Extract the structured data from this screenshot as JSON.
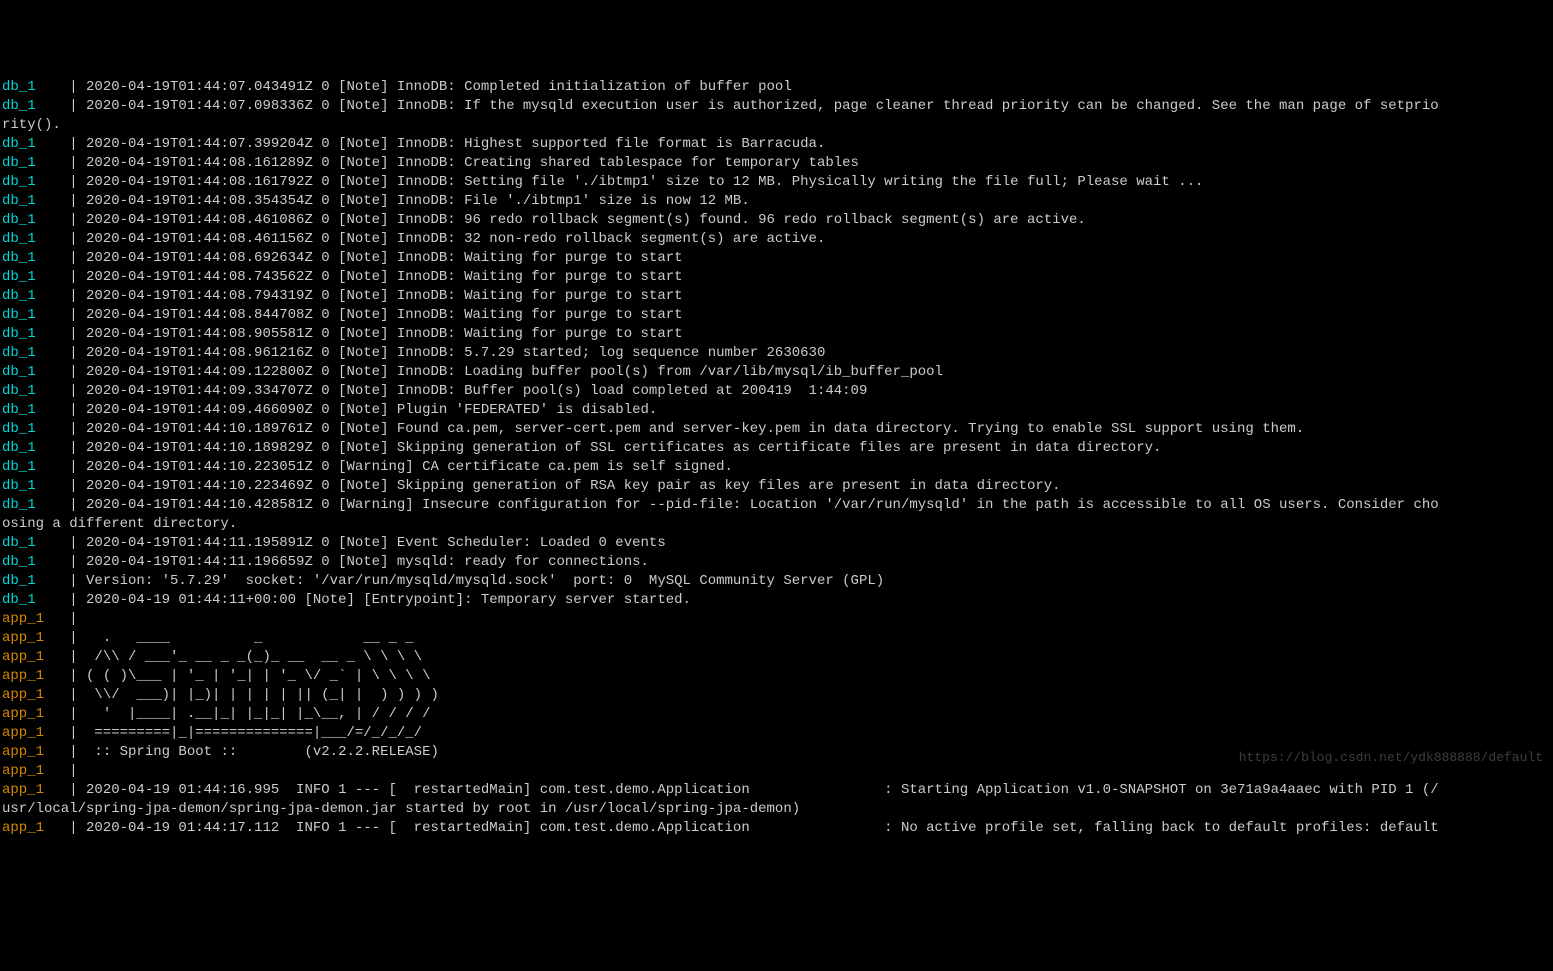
{
  "watermark": "https://blog.csdn.net/ydk888888/default",
  "lines": [
    {
      "prefix": "db_1    ",
      "prefixClass": "db-prefix",
      "text": "| 2020-04-19T01:44:07.043491Z 0 [Note] InnoDB: Completed initialization of buffer pool"
    },
    {
      "prefix": "db_1    ",
      "prefixClass": "db-prefix",
      "text": "| 2020-04-19T01:44:07.098336Z 0 [Note] InnoDB: If the mysqld execution user is authorized, page cleaner thread priority can be changed. See the man page of setprio"
    },
    {
      "prefix": "",
      "prefixClass": "log-text",
      "text": "rity()."
    },
    {
      "prefix": "db_1    ",
      "prefixClass": "db-prefix",
      "text": "| 2020-04-19T01:44:07.399204Z 0 [Note] InnoDB: Highest supported file format is Barracuda."
    },
    {
      "prefix": "db_1    ",
      "prefixClass": "db-prefix",
      "text": "| 2020-04-19T01:44:08.161289Z 0 [Note] InnoDB: Creating shared tablespace for temporary tables"
    },
    {
      "prefix": "db_1    ",
      "prefixClass": "db-prefix",
      "text": "| 2020-04-19T01:44:08.161792Z 0 [Note] InnoDB: Setting file './ibtmp1' size to 12 MB. Physically writing the file full; Please wait ..."
    },
    {
      "prefix": "db_1    ",
      "prefixClass": "db-prefix",
      "text": "| 2020-04-19T01:44:08.354354Z 0 [Note] InnoDB: File './ibtmp1' size is now 12 MB."
    },
    {
      "prefix": "db_1    ",
      "prefixClass": "db-prefix",
      "text": "| 2020-04-19T01:44:08.461086Z 0 [Note] InnoDB: 96 redo rollback segment(s) found. 96 redo rollback segment(s) are active."
    },
    {
      "prefix": "db_1    ",
      "prefixClass": "db-prefix",
      "text": "| 2020-04-19T01:44:08.461156Z 0 [Note] InnoDB: 32 non-redo rollback segment(s) are active."
    },
    {
      "prefix": "db_1    ",
      "prefixClass": "db-prefix",
      "text": "| 2020-04-19T01:44:08.692634Z 0 [Note] InnoDB: Waiting for purge to start"
    },
    {
      "prefix": "db_1    ",
      "prefixClass": "db-prefix",
      "text": "| 2020-04-19T01:44:08.743562Z 0 [Note] InnoDB: Waiting for purge to start"
    },
    {
      "prefix": "db_1    ",
      "prefixClass": "db-prefix",
      "text": "| 2020-04-19T01:44:08.794319Z 0 [Note] InnoDB: Waiting for purge to start"
    },
    {
      "prefix": "db_1    ",
      "prefixClass": "db-prefix",
      "text": "| 2020-04-19T01:44:08.844708Z 0 [Note] InnoDB: Waiting for purge to start"
    },
    {
      "prefix": "db_1    ",
      "prefixClass": "db-prefix",
      "text": "| 2020-04-19T01:44:08.905581Z 0 [Note] InnoDB: Waiting for purge to start"
    },
    {
      "prefix": "db_1    ",
      "prefixClass": "db-prefix",
      "text": "| 2020-04-19T01:44:08.961216Z 0 [Note] InnoDB: 5.7.29 started; log sequence number 2630630"
    },
    {
      "prefix": "db_1    ",
      "prefixClass": "db-prefix",
      "text": "| 2020-04-19T01:44:09.122800Z 0 [Note] InnoDB: Loading buffer pool(s) from /var/lib/mysql/ib_buffer_pool"
    },
    {
      "prefix": "db_1    ",
      "prefixClass": "db-prefix",
      "text": "| 2020-04-19T01:44:09.334707Z 0 [Note] InnoDB: Buffer pool(s) load completed at 200419  1:44:09"
    },
    {
      "prefix": "db_1    ",
      "prefixClass": "db-prefix",
      "text": "| 2020-04-19T01:44:09.466090Z 0 [Note] Plugin 'FEDERATED' is disabled."
    },
    {
      "prefix": "db_1    ",
      "prefixClass": "db-prefix",
      "text": "| 2020-04-19T01:44:10.189761Z 0 [Note] Found ca.pem, server-cert.pem and server-key.pem in data directory. Trying to enable SSL support using them."
    },
    {
      "prefix": "db_1    ",
      "prefixClass": "db-prefix",
      "text": "| 2020-04-19T01:44:10.189829Z 0 [Note] Skipping generation of SSL certificates as certificate files are present in data directory."
    },
    {
      "prefix": "db_1    ",
      "prefixClass": "db-prefix",
      "text": "| 2020-04-19T01:44:10.223051Z 0 [Warning] CA certificate ca.pem is self signed."
    },
    {
      "prefix": "db_1    ",
      "prefixClass": "db-prefix",
      "text": "| 2020-04-19T01:44:10.223469Z 0 [Note] Skipping generation of RSA key pair as key files are present in data directory."
    },
    {
      "prefix": "db_1    ",
      "prefixClass": "db-prefix",
      "text": "| 2020-04-19T01:44:10.428581Z 0 [Warning] Insecure configuration for --pid-file: Location '/var/run/mysqld' in the path is accessible to all OS users. Consider cho"
    },
    {
      "prefix": "",
      "prefixClass": "log-text",
      "text": "osing a different directory."
    },
    {
      "prefix": "db_1    ",
      "prefixClass": "db-prefix",
      "text": "| 2020-04-19T01:44:11.195891Z 0 [Note] Event Scheduler: Loaded 0 events"
    },
    {
      "prefix": "db_1    ",
      "prefixClass": "db-prefix",
      "text": "| 2020-04-19T01:44:11.196659Z 0 [Note] mysqld: ready for connections."
    },
    {
      "prefix": "db_1    ",
      "prefixClass": "db-prefix",
      "text": "| Version: '5.7.29'  socket: '/var/run/mysqld/mysqld.sock'  port: 0  MySQL Community Server (GPL)"
    },
    {
      "prefix": "db_1    ",
      "prefixClass": "db-prefix",
      "text": "| 2020-04-19 01:44:11+00:00 [Note] [Entrypoint]: Temporary server started."
    },
    {
      "prefix": "app_1   ",
      "prefixClass": "app-prefix",
      "text": "| "
    },
    {
      "prefix": "app_1   ",
      "prefixClass": "app-prefix",
      "text": "|   .   ____          _            __ _ _"
    },
    {
      "prefix": "app_1   ",
      "prefixClass": "app-prefix",
      "text": "|  /\\\\ / ___'_ __ _ _(_)_ __  __ _ \\ \\ \\ \\"
    },
    {
      "prefix": "app_1   ",
      "prefixClass": "app-prefix",
      "text": "| ( ( )\\___ | '_ | '_| | '_ \\/ _` | \\ \\ \\ \\"
    },
    {
      "prefix": "app_1   ",
      "prefixClass": "app-prefix",
      "text": "|  \\\\/  ___)| |_)| | | | | || (_| |  ) ) ) )"
    },
    {
      "prefix": "app_1   ",
      "prefixClass": "app-prefix",
      "text": "|   '  |____| .__|_| |_|_| |_\\__, | / / / /"
    },
    {
      "prefix": "app_1   ",
      "prefixClass": "app-prefix",
      "text": "|  =========|_|==============|___/=/_/_/_/"
    },
    {
      "prefix": "app_1   ",
      "prefixClass": "app-prefix",
      "text": "|  :: Spring Boot ::        (v2.2.2.RELEASE)"
    },
    {
      "prefix": "app_1   ",
      "prefixClass": "app-prefix",
      "text": "| "
    },
    {
      "prefix": "app_1   ",
      "prefixClass": "app-prefix",
      "text": "| 2020-04-19 01:44:16.995  INFO 1 --- [  restartedMain] com.test.demo.Application                : Starting Application v1.0-SNAPSHOT on 3e71a9a4aaec with PID 1 (/"
    },
    {
      "prefix": "",
      "prefixClass": "log-text",
      "text": "usr/local/spring-jpa-demon/spring-jpa-demon.jar started by root in /usr/local/spring-jpa-demon)"
    },
    {
      "prefix": "app_1   ",
      "prefixClass": "app-prefix",
      "text": "| 2020-04-19 01:44:17.112  INFO 1 --- [  restartedMain] com.test.demo.Application                : No active profile set, falling back to default profiles: default"
    }
  ]
}
